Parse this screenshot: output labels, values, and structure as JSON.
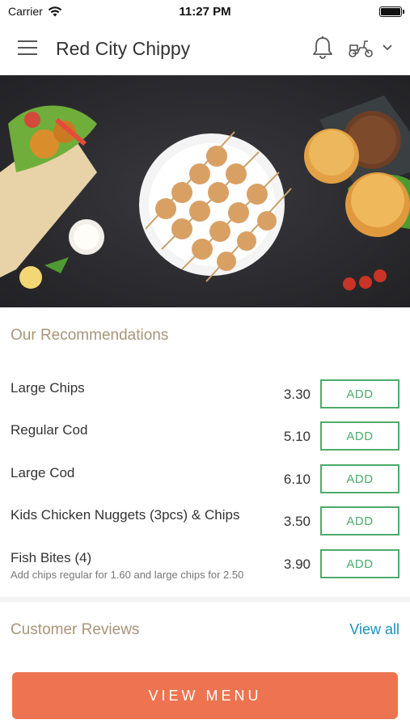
{
  "status_bar": {
    "carrier": "Carrier",
    "time": "11:27 PM"
  },
  "header": {
    "title": "Red City Chippy",
    "icons": [
      "menu-icon",
      "bell-icon",
      "scooter-icon",
      "chevron-down-icon"
    ]
  },
  "recommendations": {
    "title": "Our Recommendations",
    "add_label": "ADD",
    "items": [
      {
        "name": "Large Chips",
        "price": "3.30",
        "note": ""
      },
      {
        "name": "Regular Cod",
        "price": "5.10",
        "note": ""
      },
      {
        "name": "Large Cod",
        "price": "6.10",
        "note": ""
      },
      {
        "name": "Kids Chicken Nuggets (3pcs) & Chips",
        "price": "3.50",
        "note": ""
      },
      {
        "name": "Fish Bites (4)",
        "price": "3.90",
        "note": "Add chips regular for 1.60 and large chips for 2.50"
      }
    ]
  },
  "reviews": {
    "title": "Customer Reviews",
    "view_all": "View all"
  },
  "footer": {
    "view_menu": "VIEW MENU"
  },
  "colors": {
    "accent_green": "#4eaa6b",
    "section_title": "#a89479",
    "link_blue": "#1c8fbd",
    "cta_orange": "#ee7350"
  }
}
